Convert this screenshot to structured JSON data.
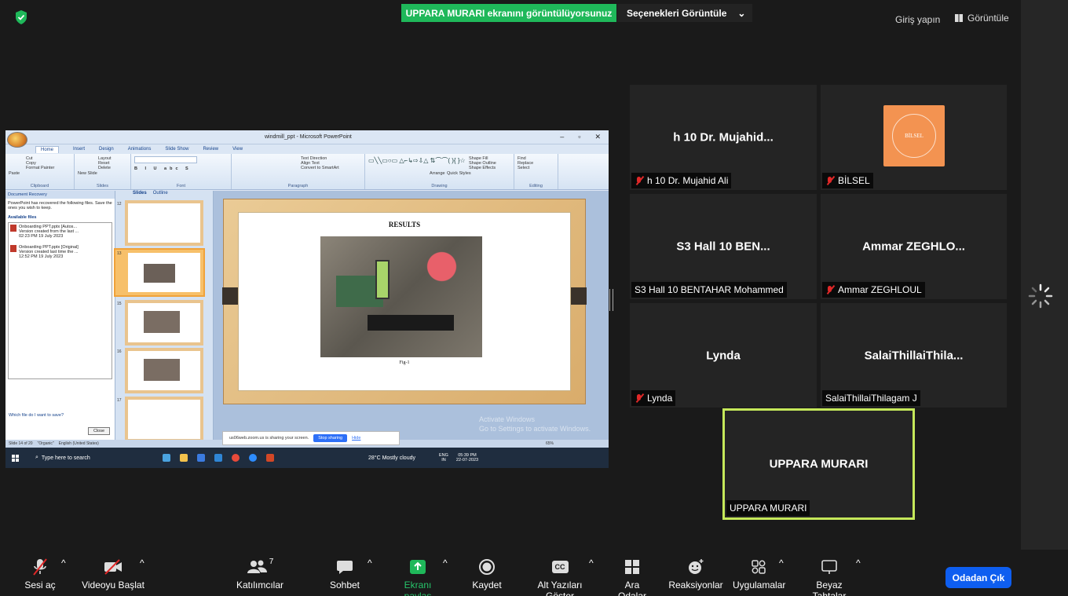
{
  "top_bar": {
    "share_banner": "UPPARA MURARI ekranını görüntülüyorsunuz",
    "view_options": "Seçenekleri Görüntüle",
    "sign_in": "Giriş yapın",
    "view": "Görüntüle"
  },
  "shared_screen": {
    "window_title": "windmill_ppt - Microsoft PowerPoint",
    "ribbon_tabs": [
      "Home",
      "Insert",
      "Design",
      "Animations",
      "Slide Show",
      "Review",
      "View"
    ],
    "ribbon_groups": {
      "clipboard": "Clipboard",
      "slides": "Slides",
      "font": "Font",
      "paragraph": "Paragraph",
      "drawing": "Drawing",
      "editing": "Editing"
    },
    "ribbon_buttons": {
      "paste": "Paste",
      "cut": "Cut",
      "copy": "Copy",
      "format_painter": "Format Painter",
      "new_slide": "New Slide",
      "layout": "Layout",
      "reset": "Reset",
      "delete": "Delete",
      "text_direction": "Text Direction",
      "align_text": "Align Text",
      "convert_smartart": "Convert to SmartArt",
      "arrange": "Arrange",
      "quick_styles": "Quick Styles",
      "shape_fill": "Shape Fill",
      "shape_outline": "Shape Outline",
      "shape_effects": "Shape Effects",
      "find": "Find",
      "replace": "Replace",
      "select": "Select"
    },
    "doc_recovery": {
      "header": "Document Recovery",
      "message": "PowerPoint has recovered the following files. Save the ones you wish to keep.",
      "available": "Available files",
      "files": [
        {
          "name": "Onboarding PPT.pptx [Autos...",
          "desc": "Version created from the last ...",
          "time": "02:23 PM 19 July 2023"
        },
        {
          "name": "Onboarding PPT.pptx [Original]",
          "desc": "Version created last time the ...",
          "time": "12:52 PM 19 July 2023"
        }
      ],
      "which_file": "Which file do I want to save?",
      "close": "Close"
    },
    "slides_tabs": [
      "Slides",
      "Outline"
    ],
    "thumb_numbers": [
      "12",
      "13",
      "15",
      "16",
      "17"
    ],
    "slide": {
      "title": "RESULTS",
      "caption": "Fig-1"
    },
    "status_bar": {
      "slide_count": "Slide 14 of 20",
      "theme": "\"Organic\"",
      "language": "English (United States)",
      "zoom": "65%"
    },
    "sharing_pill": {
      "text": "us06web.zoom.us is sharing your screen.",
      "stop": "Stop sharing",
      "hide": "Hide"
    },
    "activate_windows": [
      "Activate Windows",
      "Go to Settings to activate Windows."
    ],
    "taskbar": {
      "search": "Type here to search",
      "weather": "28°C  Mostly cloudy",
      "lang": "ENG",
      "region": "IN",
      "time": "05:39 PM",
      "date": "22-07-2023"
    }
  },
  "participants": [
    {
      "display": "h 10 Dr. Mujahid...",
      "label": "h 10 Dr. Mujahid Ali",
      "muted": true
    },
    {
      "display": "",
      "label": "BİLSEL",
      "muted": true,
      "logo_text": "BİLSEL"
    },
    {
      "display": "S3  Hall 10  BEN...",
      "label": "S3  Hall 10  BENTAHAR Mohammed",
      "muted": false
    },
    {
      "display": "Ammar  ZEGHLO...",
      "label": "Ammar ZEGHLOUL",
      "muted": true
    },
    {
      "display": "Lynda",
      "label": "Lynda",
      "muted": true
    },
    {
      "display": "SalaiThillaiThila...",
      "label": "SalaiThillaiThilagam J",
      "muted": false
    },
    {
      "display": "UPPARA MURARI",
      "label": "UPPARA MURARI",
      "muted": false
    }
  ],
  "toolbar": {
    "unmute": "Sesi aç",
    "start_video": "Videoyu Başlat",
    "participants": "Katılımcılar",
    "participants_count": "7",
    "chat": "Sohbet",
    "share_screen": "Ekranı paylaş",
    "record": "Kaydet",
    "captions": "Alt Yazıları Göster",
    "cc": "CC",
    "breakout": "Ara Odalar",
    "reactions": "Reaksiyonlar",
    "apps": "Uygulamalar",
    "whiteboards": "Beyaz Tahtalar",
    "leave": "Odadan Çık"
  },
  "colors": {
    "banner_green": "#1fb85a",
    "active_speaker": "#c5e85a",
    "leave_blue": "#0e5ef0",
    "muted_red": "#e02828"
  }
}
